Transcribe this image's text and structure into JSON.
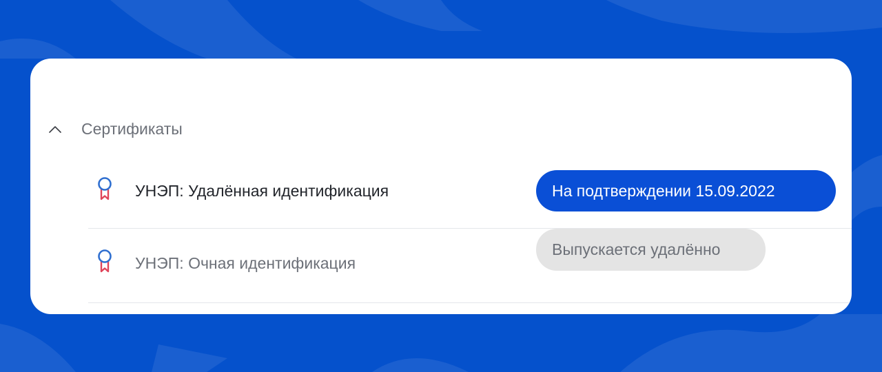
{
  "colors": {
    "background": "#0551cc",
    "card": "#ffffff",
    "badge_active_bg": "#0a4fd6",
    "badge_muted_bg": "#e4e4e4",
    "icon_ring": "#2f6fd0",
    "icon_ribbon": "#e0445a"
  },
  "section": {
    "title": "Сертификаты",
    "expanded": true,
    "toggle_icon": "chevron-up-icon"
  },
  "certificates": [
    {
      "name": "УНЭП: Удалённая идентификация",
      "status": "На подтверждении 15.09.2022",
      "status_style": "active",
      "icon": "certificate-ribbon-icon"
    },
    {
      "name": "УНЭП: Очная идентификация",
      "status": "Выпускается удалённо",
      "status_style": "muted",
      "icon": "certificate-ribbon-icon"
    }
  ]
}
